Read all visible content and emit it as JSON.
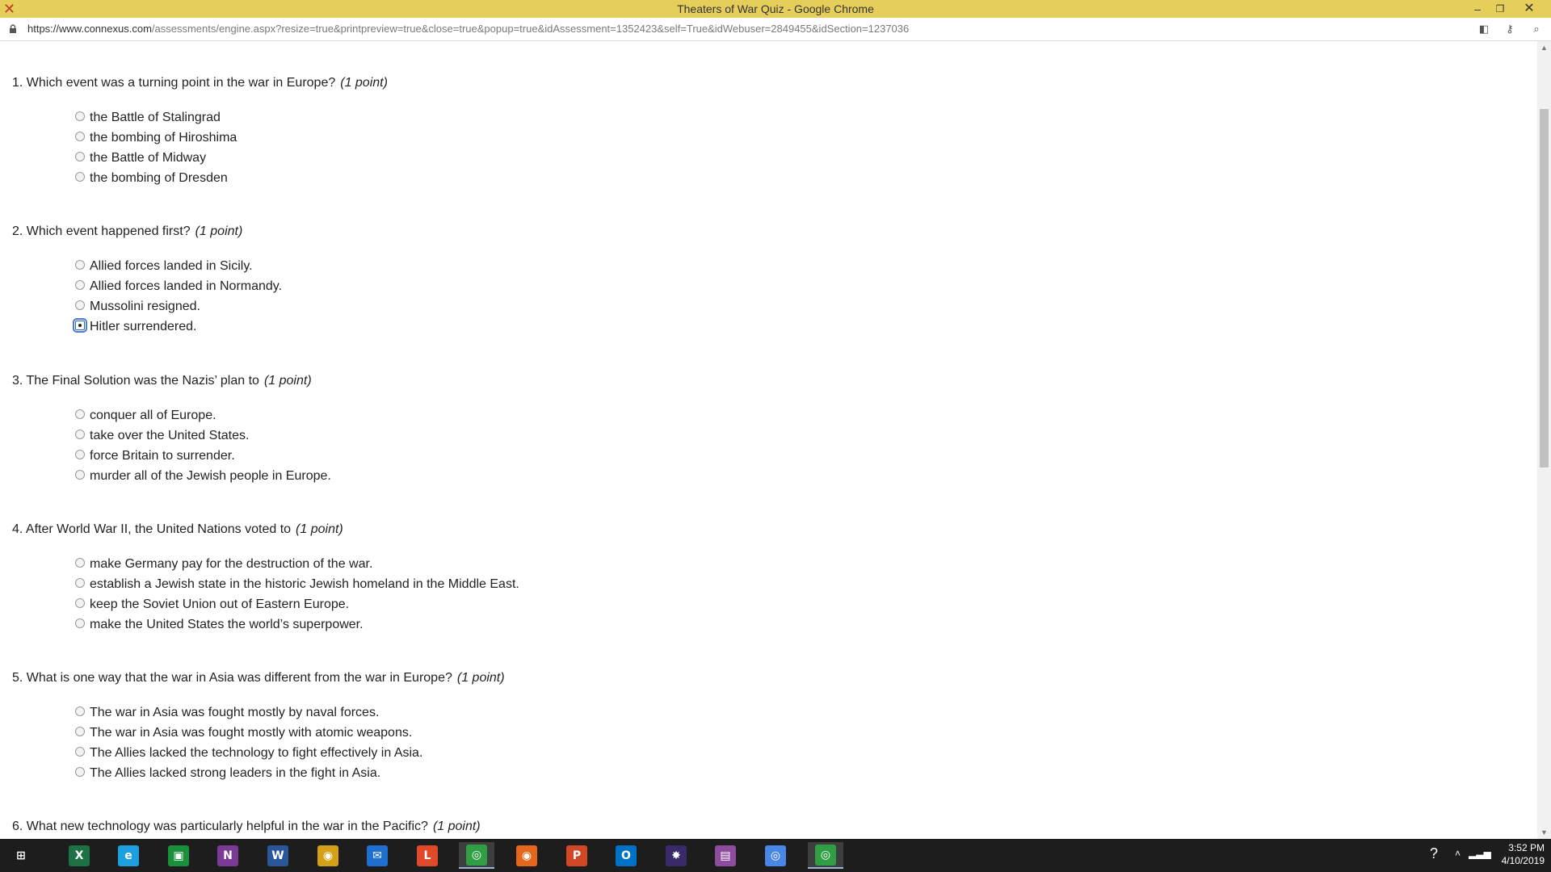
{
  "window": {
    "title": "Theaters of War Quiz - Google Chrome",
    "controls": {
      "minimize": "–",
      "maximize": "❐",
      "close": "✕"
    }
  },
  "address": {
    "domain": "https://www.connexus.com",
    "path": "/assessments/engine.aspx?resize=true&printpreview=true&close=true&popup=true&idAssessment=1352423&self=True&idWebuser=2849455&idSection=1237036"
  },
  "questions": [
    {
      "number": "1.",
      "text": "Which event was a turning point in the war in Europe?",
      "points": "(1 point)",
      "options": [
        "the Battle of Stalingrad",
        "the bombing of Hiroshima",
        "the Battle of Midway",
        "the bombing of Dresden"
      ],
      "selected": null
    },
    {
      "number": "2.",
      "text": "Which event happened first?",
      "points": "(1 point)",
      "options": [
        "Allied forces landed in Sicily.",
        "Allied forces landed in Normandy.",
        "Mussolini resigned.",
        "Hitler surrendered."
      ],
      "selected": 3
    },
    {
      "number": "3.",
      "text": "The Final Solution was the Nazis’ plan to",
      "points": "(1 point)",
      "options": [
        "conquer all of Europe.",
        "take over the United States.",
        "force Britain to surrender.",
        "murder all of the Jewish people in Europe."
      ],
      "selected": null
    },
    {
      "number": "4.",
      "text": "After World War II, the United Nations voted to",
      "points": "(1 point)",
      "options": [
        "make Germany pay for the destruction of the war.",
        "establish a Jewish state in the historic Jewish homeland in the Middle East.",
        "keep the Soviet Union out of Eastern Europe.",
        "make the United States the world’s superpower."
      ],
      "selected": null
    },
    {
      "number": "5.",
      "text": "What is one way that the war in Asia was different from the war in Europe?",
      "points": "(1 point)",
      "options": [
        "The war in Asia was fought mostly by naval forces.",
        "The war in Asia was fought mostly with atomic weapons.",
        "The Allies lacked the technology to fight effectively in Asia.",
        "The Allies lacked strong leaders in the fight in Asia."
      ],
      "selected": null
    },
    {
      "number": "6.",
      "text": "What new technology was particularly helpful in the war in the Pacific?",
      "points": "(1 point)",
      "options": [],
      "selected": null
    }
  ],
  "taskbar": {
    "apps": [
      {
        "name": "start-icon",
        "glyph": "⊞",
        "color": "#1d1d1d"
      },
      {
        "name": "excel-icon",
        "glyph": "X",
        "color": "#1e7145"
      },
      {
        "name": "internet-explorer-icon",
        "glyph": "e",
        "color": "#1ea0e0"
      },
      {
        "name": "store-icon",
        "glyph": "▣",
        "color": "#1a8f3c"
      },
      {
        "name": "onenote-icon",
        "glyph": "N",
        "color": "#7b3a96"
      },
      {
        "name": "word-icon",
        "glyph": "W",
        "color": "#2b579a"
      },
      {
        "name": "media-icon",
        "glyph": "◉",
        "color": "#d4a017"
      },
      {
        "name": "mail-icon",
        "glyph": "✉",
        "color": "#1f6fd1"
      },
      {
        "name": "ucertify-icon",
        "glyph": "L",
        "color": "#e04a2a"
      },
      {
        "name": "chrome-icon",
        "glyph": "◎",
        "color": "#2f9e44",
        "active": true
      },
      {
        "name": "firefox-icon",
        "glyph": "◉",
        "color": "#e5671c"
      },
      {
        "name": "powerpoint-icon",
        "glyph": "P",
        "color": "#d24726"
      },
      {
        "name": "outlook-icon",
        "glyph": "O",
        "color": "#0072c6"
      },
      {
        "name": "paint-icon",
        "glyph": "✸",
        "color": "#3a2a6a"
      },
      {
        "name": "calendar-icon",
        "glyph": "▤",
        "color": "#8e4c9e"
      },
      {
        "name": "chrome-alt-icon",
        "glyph": "◎",
        "color": "#4a86e8"
      },
      {
        "name": "chrome-window-icon",
        "glyph": "◎",
        "color": "#2f9e44",
        "active": true
      }
    ],
    "time": "3:52 PM",
    "date": "4/10/2019"
  }
}
